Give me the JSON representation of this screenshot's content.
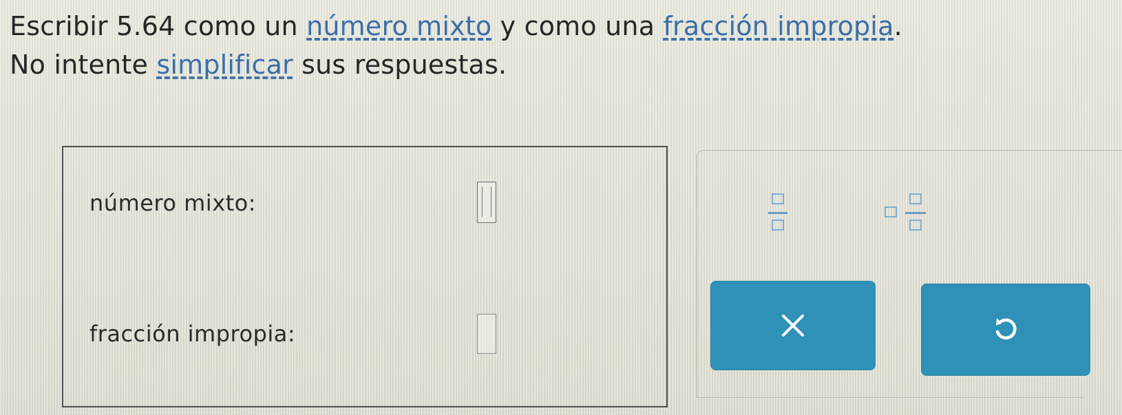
{
  "question": {
    "part1": "Escribir 5.64 como un ",
    "link_mixed": "número mixto",
    "part2": " y como una ",
    "link_improper": "fracción impropia",
    "part3": ".",
    "part4": "No intente ",
    "link_simplify": "simplificar",
    "part5": " sus respuestas."
  },
  "answers": {
    "mixed_label": "número mixto:",
    "mixed_value": "",
    "improper_label": "fracción impropia:",
    "improper_value": ""
  },
  "tools": {
    "fraction_icon": "fraction-template-icon",
    "mixed_number_icon": "mixed-number-template-icon",
    "clear_icon": "close-icon",
    "undo_icon": "undo-icon"
  },
  "colors": {
    "link": "#3b6ea8",
    "button": "#2f90b8",
    "template_outline": "#7aaed4"
  }
}
